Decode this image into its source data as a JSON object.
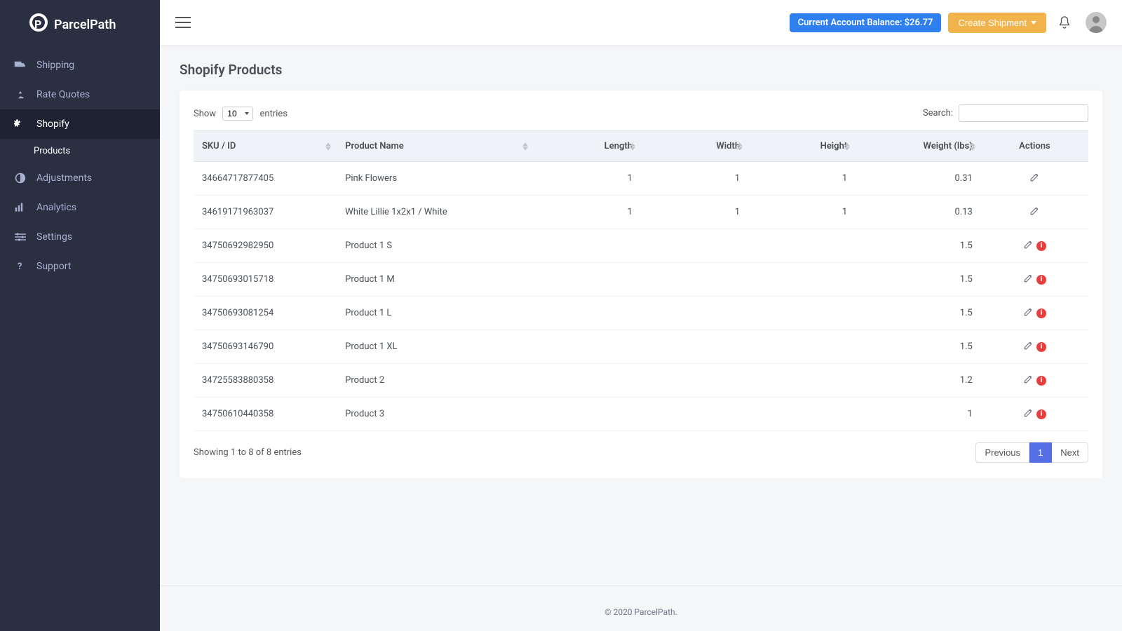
{
  "brand": "ParcelPath",
  "sidebar": {
    "items": [
      {
        "label": "Shipping"
      },
      {
        "label": "Rate Quotes"
      },
      {
        "label": "Shopify"
      },
      {
        "label": "Adjustments"
      },
      {
        "label": "Analytics"
      },
      {
        "label": "Settings"
      },
      {
        "label": "Support"
      }
    ],
    "subitem": {
      "label": "Products"
    }
  },
  "topbar": {
    "balance_label": "Current Account Balance: $26.77",
    "create_label": "Create Shipment"
  },
  "page": {
    "title": "Shopify Products"
  },
  "controls": {
    "show_label": "Show",
    "entries_value": "10",
    "entries_label": "entries",
    "search_label": "Search:"
  },
  "columns": {
    "sku": "SKU / ID",
    "name": "Product Name",
    "length": "Length",
    "width": "Width",
    "height": "Height",
    "weight": "Weight (lbs)",
    "actions": "Actions"
  },
  "rows": [
    {
      "sku": "34664717877405",
      "name": "Pink Flowers",
      "length": "1",
      "width": "1",
      "height": "1",
      "weight": "0.31",
      "warn": false
    },
    {
      "sku": "34619171963037",
      "name": "White Lillie 1x2x1 / White",
      "length": "1",
      "width": "1",
      "height": "1",
      "weight": "0.13",
      "warn": false
    },
    {
      "sku": "34750692982950",
      "name": "Product 1 S",
      "length": "",
      "width": "",
      "height": "",
      "weight": "1.5",
      "warn": true
    },
    {
      "sku": "34750693015718",
      "name": "Product 1 M",
      "length": "",
      "width": "",
      "height": "",
      "weight": "1.5",
      "warn": true
    },
    {
      "sku": "34750693081254",
      "name": "Product 1 L",
      "length": "",
      "width": "",
      "height": "",
      "weight": "1.5",
      "warn": true
    },
    {
      "sku": "34750693146790",
      "name": "Product 1 XL",
      "length": "",
      "width": "",
      "height": "",
      "weight": "1.5",
      "warn": true
    },
    {
      "sku": "34725583880358",
      "name": "Product 2",
      "length": "",
      "width": "",
      "height": "",
      "weight": "1.2",
      "warn": true
    },
    {
      "sku": "34750610440358",
      "name": "Product 3",
      "length": "",
      "width": "",
      "height": "",
      "weight": "1",
      "warn": true
    }
  ],
  "footer_info": "Showing 1 to 8 of 8 entries",
  "pagination": {
    "prev": "Previous",
    "page": "1",
    "next": "Next"
  },
  "copyright": "© 2020 ParcelPath."
}
